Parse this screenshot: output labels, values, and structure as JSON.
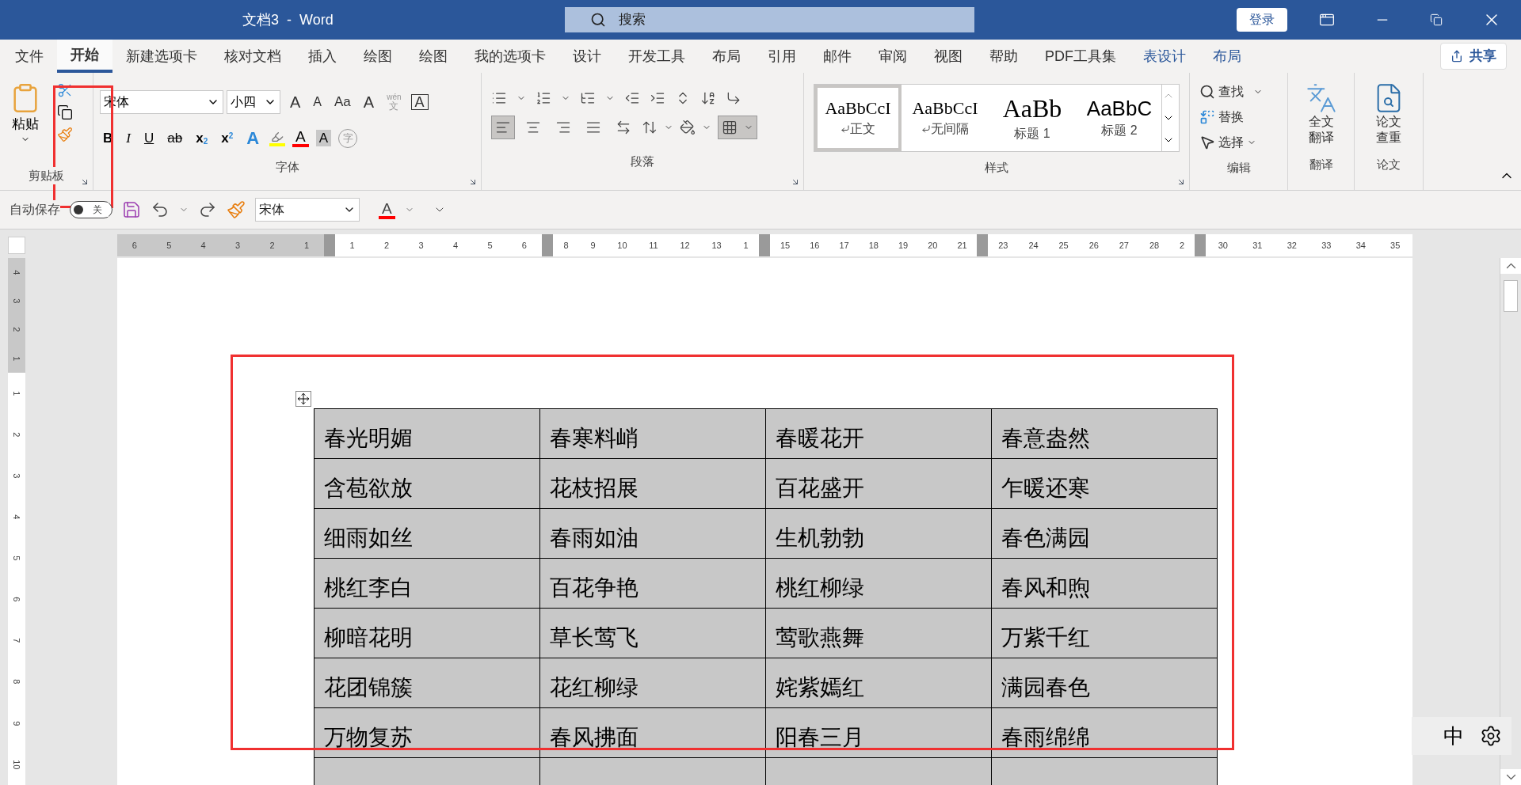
{
  "window": {
    "title": "文档3  -  Word",
    "search_placeholder": "搜索",
    "login_button": "登录"
  },
  "tabs": [
    {
      "label": "文件",
      "selected": false,
      "kind": "normal"
    },
    {
      "label": "开始",
      "selected": true,
      "kind": "normal"
    },
    {
      "label": "新建选项卡",
      "selected": false,
      "kind": "normal"
    },
    {
      "label": "核对文档",
      "selected": false,
      "kind": "normal"
    },
    {
      "label": "插入",
      "selected": false,
      "kind": "normal"
    },
    {
      "label": "绘图",
      "selected": false,
      "kind": "normal"
    },
    {
      "label": "绘图",
      "selected": false,
      "kind": "normal"
    },
    {
      "label": "我的选项卡",
      "selected": false,
      "kind": "normal"
    },
    {
      "label": "设计",
      "selected": false,
      "kind": "normal"
    },
    {
      "label": "开发工具",
      "selected": false,
      "kind": "normal"
    },
    {
      "label": "布局",
      "selected": false,
      "kind": "normal"
    },
    {
      "label": "引用",
      "selected": false,
      "kind": "normal"
    },
    {
      "label": "邮件",
      "selected": false,
      "kind": "normal"
    },
    {
      "label": "审阅",
      "selected": false,
      "kind": "normal"
    },
    {
      "label": "视图",
      "selected": false,
      "kind": "normal"
    },
    {
      "label": "帮助",
      "selected": false,
      "kind": "normal"
    },
    {
      "label": "PDF工具集",
      "selected": false,
      "kind": "normal"
    },
    {
      "label": "表设计",
      "selected": false,
      "kind": "context"
    },
    {
      "label": "布局",
      "selected": false,
      "kind": "context"
    }
  ],
  "share_button": "共享",
  "ribbon": {
    "clipboard": {
      "paste": "粘贴",
      "group": "剪贴板"
    },
    "font": {
      "font_name": "宋体",
      "font_size": "小四",
      "group": "字体",
      "row1": [
        {
          "kind": "grow",
          "glyph": "A"
        },
        {
          "kind": "shrink",
          "glyph": "A"
        },
        {
          "kind": "case",
          "glyph": "Aa"
        },
        {
          "kind": "clear",
          "glyph": "A"
        },
        {
          "kind": "phonetic",
          "glyph": "wén",
          "sub": "文"
        },
        {
          "kind": "border",
          "glyph": "A"
        }
      ],
      "row2": [
        {
          "kind": "bold",
          "glyph": "B"
        },
        {
          "kind": "italic",
          "glyph": "I"
        },
        {
          "kind": "underline",
          "glyph": "U"
        },
        {
          "kind": "strike",
          "glyph": "ab"
        },
        {
          "kind": "subscript",
          "glyph": "x",
          "sub": "2"
        },
        {
          "kind": "superscript",
          "glyph": "x",
          "sub": "2"
        },
        {
          "kind": "effect",
          "glyph": "A"
        },
        {
          "kind": "highlight"
        },
        {
          "kind": "color",
          "glyph": "A"
        },
        {
          "kind": "shading",
          "glyph": "A"
        },
        {
          "kind": "enclose",
          "glyph": "字"
        }
      ]
    },
    "paragraph": {
      "group": "段落",
      "alignment": [
        {
          "kind": "left",
          "selected": true
        },
        {
          "kind": "center",
          "selected": false
        },
        {
          "kind": "right",
          "selected": false
        },
        {
          "kind": "justify",
          "selected": false
        },
        {
          "kind": "distributed",
          "selected": false
        }
      ],
      "borders": {
        "selected": true
      }
    },
    "styles": {
      "group": "样式",
      "items": [
        {
          "preview": "AaBbCcI",
          "name": "正文",
          "kind": "body",
          "selected": true
        },
        {
          "preview": "AaBbCcI",
          "name": "无间隔",
          "kind": "body",
          "selected": false
        },
        {
          "preview": "AaBb",
          "name": "标题 1",
          "kind": "heading1",
          "selected": false
        },
        {
          "preview": "AaBbC",
          "name": "标题 2",
          "kind": "heading2",
          "selected": false
        }
      ]
    },
    "editing": {
      "group": "编辑",
      "find": "查找",
      "replace": "替换",
      "select": "选择"
    },
    "translate": {
      "group": "翻译",
      "button": "全文翻译"
    },
    "thesis": {
      "group": "论文",
      "button": "论文查重"
    }
  },
  "quick_access": {
    "autosave": {
      "label": "自动保存",
      "state": "关",
      "on": false
    },
    "font_name": "宋体",
    "font_color_glyph": "A"
  },
  "ruler": {
    "horizontal": [
      {
        "kind": "margin",
        "labels": [
          "6",
          "5",
          "4",
          "3",
          "2",
          "1"
        ]
      },
      {
        "kind": "body",
        "labels": [
          "1",
          "2",
          "3",
          "4",
          "5",
          "6"
        ]
      },
      {
        "kind": "body",
        "labels": [
          "8",
          "9",
          "10",
          "11",
          "12",
          "13",
          "1"
        ]
      },
      {
        "kind": "body",
        "labels": [
          "15",
          "16",
          "17",
          "18",
          "19",
          "20",
          "21"
        ]
      },
      {
        "kind": "body",
        "labels": [
          "23",
          "24",
          "25",
          "26",
          "27",
          "28",
          "2"
        ]
      },
      {
        "kind": "body",
        "labels": [
          "30",
          "31",
          "32",
          "33",
          "34",
          "35"
        ]
      }
    ],
    "vertical": [
      {
        "kind": "margin",
        "labels": [
          "4",
          "3",
          "2",
          "1"
        ]
      },
      {
        "kind": "body",
        "labels": [
          "1",
          "2",
          "3",
          "4",
          "5",
          "6",
          "7",
          "8",
          "9",
          "10"
        ]
      }
    ]
  },
  "table": {
    "rows": [
      [
        "春光明媚",
        "春寒料峭",
        "春暖花开",
        "春意盎然"
      ],
      [
        "含苞欲放",
        "花枝招展",
        "百花盛开",
        "乍暖还寒"
      ],
      [
        "细雨如丝",
        "春雨如油",
        "生机勃勃",
        "春色满园"
      ],
      [
        "桃红李白",
        "百花争艳",
        "桃红柳绿",
        "春风和煦"
      ],
      [
        "柳暗花明",
        "草长莺飞",
        "莺歌燕舞",
        "万紫千红"
      ],
      [
        "花团锦簇",
        "花红柳绿",
        "姹紫嫣红",
        "满园春色"
      ],
      [
        "万物复苏",
        "春风拂面",
        "阳春三月",
        "春雨绵绵"
      ]
    ]
  },
  "ime": {
    "mode": "中"
  }
}
